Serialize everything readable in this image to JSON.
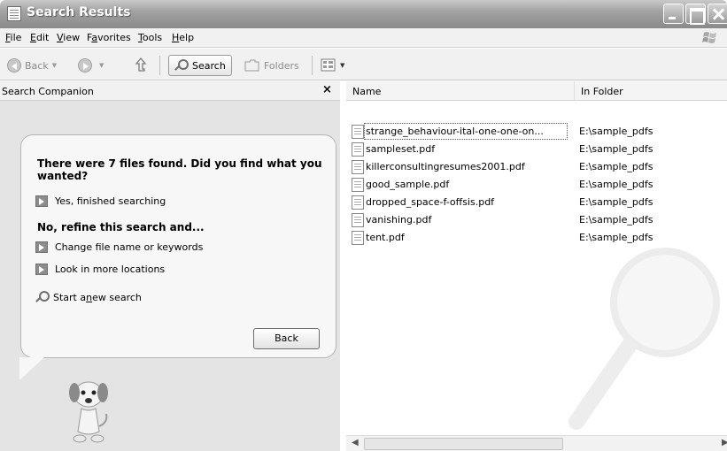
{
  "window": {
    "title": "Search Results"
  },
  "menu": [
    {
      "label": "File",
      "acc": "F",
      "rest": "ile"
    },
    {
      "label": "Edit",
      "acc": "E",
      "rest": "dit"
    },
    {
      "label": "View",
      "acc": "V",
      "rest": "iew"
    },
    {
      "label": "Favorites",
      "acc": "a",
      "pre": "F",
      "rest": "vorites"
    },
    {
      "label": "Tools",
      "acc": "T",
      "rest": "ools"
    },
    {
      "label": "Help",
      "acc": "H",
      "rest": "elp"
    }
  ],
  "toolbar": {
    "back": "Back",
    "search": "Search",
    "folders": "Folders"
  },
  "companion": {
    "title": "Search Companion",
    "close": "×",
    "question": "There were 7 files found. Did you find what you wanted?",
    "yes": "Yes, finished searching",
    "refine_heading": "No, refine this search and...",
    "change": "Change file name or keywords",
    "look": "Look in more locations",
    "start_pre": "Start a ",
    "start_acc": "n",
    "start_post": "ew search",
    "back_button": "Back"
  },
  "results": {
    "columns": [
      "Name",
      "In Folder"
    ],
    "rows": [
      {
        "name": "strange_behaviour-ital-one-one-on...",
        "folder": "E:\\sample_pdfs"
      },
      {
        "name": "sampleset.pdf",
        "folder": "E:\\sample_pdfs"
      },
      {
        "name": "killerconsultingresumes2001.pdf",
        "folder": "E:\\sample_pdfs"
      },
      {
        "name": "good_sample.pdf",
        "folder": "E:\\sample_pdfs"
      },
      {
        "name": "dropped_space-f-offsis.pdf",
        "folder": "E:\\sample_pdfs"
      },
      {
        "name": "vanishing.pdf",
        "folder": "E:\\sample_pdfs"
      },
      {
        "name": "tent.pdf",
        "folder": "E:\\sample_pdfs"
      }
    ]
  }
}
